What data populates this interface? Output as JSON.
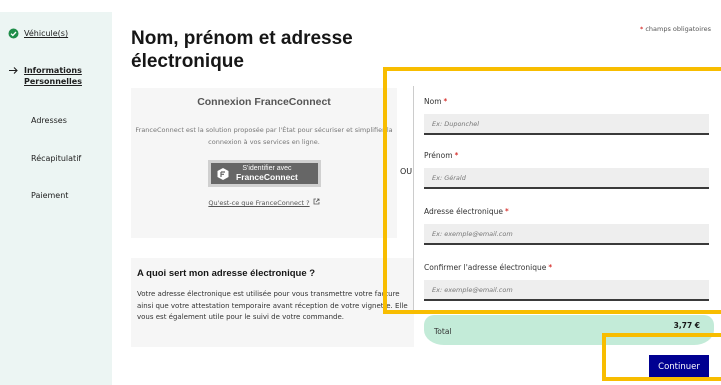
{
  "sidebar": {
    "steps": [
      {
        "label": "Véhicule(s)",
        "state": "done"
      },
      {
        "label": "Informations Personnelles",
        "state": "current"
      },
      {
        "label": "Adresses",
        "state": "todo"
      },
      {
        "label": "Récapitulatif",
        "state": "todo"
      },
      {
        "label": "Paiement",
        "state": "todo"
      }
    ]
  },
  "page": {
    "title": "Nom, prénom et adresse électronique",
    "required_note": "champs obligatoires",
    "required_star": "*"
  },
  "franceconnect": {
    "title": "Connexion FranceConnect",
    "description": "FranceConnect est la solution proposée par l'État pour sécuriser et simplifier la connexion à vos services en ligne.",
    "button_line1": "S'identifier avec",
    "button_line2": "FranceConnect",
    "link": "Qu'est-ce que FranceConnect ?"
  },
  "separator": "OU",
  "info": {
    "title": "A quoi sert mon adresse électronique ?",
    "text": "Votre adresse électronique est utilisée pour vous transmettre votre facture ainsi que votre attestation temporaire avant réception de votre vignette. Elle vous est également utile pour le suivi de votre commande."
  },
  "form": {
    "nom": {
      "label": "Nom",
      "placeholder": "Ex: Duponchel",
      "value": ""
    },
    "prenom": {
      "label": "Prénom",
      "placeholder": "Ex: Gérald",
      "value": ""
    },
    "email": {
      "label": "Adresse électronique",
      "placeholder": "Ex: exemple@email.com",
      "value": ""
    },
    "email_confirm": {
      "label": "Confirmer l'adresse électronique",
      "placeholder": "Ex: exemple@email.com",
      "value": ""
    },
    "required_star": "*"
  },
  "total": {
    "label": "Total",
    "value": "3,77 €"
  },
  "actions": {
    "continue_label": "Continuer"
  },
  "colors": {
    "primary": "#000091",
    "success": "#1f8d49",
    "highlight": "#f8bd00",
    "total_bg": "#c3ebd8",
    "sidebar_bg": "#ecf5f3"
  }
}
